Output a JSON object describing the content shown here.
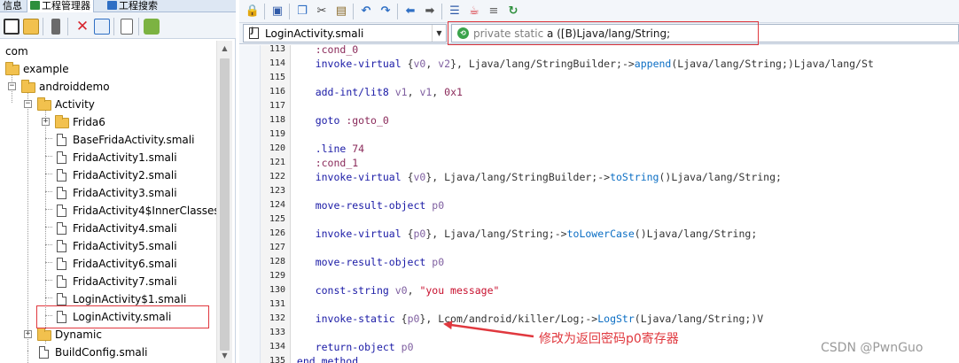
{
  "left_panel": {
    "tabs": [
      {
        "label": "信息"
      },
      {
        "label": "工程管理器"
      },
      {
        "label": "工程搜索"
      }
    ],
    "tree": [
      {
        "label": "com"
      },
      {
        "label": "example"
      },
      {
        "label": "androiddemo"
      },
      {
        "label": "Activity"
      },
      {
        "label": "Frida6"
      },
      {
        "label": "BaseFridaActivity.smali"
      },
      {
        "label": "FridaActivity1.smali"
      },
      {
        "label": "FridaActivity2.smali"
      },
      {
        "label": "FridaActivity3.smali"
      },
      {
        "label": "FridaActivity4$InnerClasses.s"
      },
      {
        "label": "FridaActivity4.smali"
      },
      {
        "label": "FridaActivity5.smali"
      },
      {
        "label": "FridaActivity6.smali"
      },
      {
        "label": "FridaActivity7.smali"
      },
      {
        "label": "LoginActivity$1.smali"
      },
      {
        "label": "LoginActivity.smali"
      },
      {
        "label": "Dynamic"
      },
      {
        "label": "BuildConfig.smali"
      }
    ]
  },
  "editor": {
    "file_name": "LoginActivity.smali",
    "method_modifiers": "private static",
    "method_signature": "a ([B)Ljava/lang/String;",
    "lines": [
      {
        "no": "113",
        "tokens": [
          {
            "t": "    "
          },
          {
            "c": "t-l",
            "t": ":cond_0"
          }
        ]
      },
      {
        "no": "114",
        "tokens": [
          {
            "t": "    "
          },
          {
            "c": "t-i",
            "t": "invoke-virtual "
          },
          {
            "c": "t-d",
            "t": "{"
          },
          {
            "c": "t-r",
            "t": "v0"
          },
          {
            "c": "t-d",
            "t": ", "
          },
          {
            "c": "t-r",
            "t": "v2"
          },
          {
            "c": "t-d",
            "t": "}, Ljava/lang/StringBuilder;->"
          },
          {
            "c": "t-m",
            "t": "append"
          },
          {
            "c": "t-d",
            "t": "(Ljava/lang/String;)Ljava/lang/St"
          }
        ]
      },
      {
        "no": "115",
        "tokens": [
          {
            "t": ""
          }
        ]
      },
      {
        "no": "116",
        "tokens": [
          {
            "t": "    "
          },
          {
            "c": "t-i",
            "t": "add-int/lit8 "
          },
          {
            "c": "t-r",
            "t": "v1"
          },
          {
            "c": "t-d",
            "t": ", "
          },
          {
            "c": "t-r",
            "t": "v1"
          },
          {
            "c": "t-d",
            "t": ", "
          },
          {
            "c": "t-n",
            "t": "0x1"
          }
        ]
      },
      {
        "no": "117",
        "tokens": [
          {
            "t": ""
          }
        ]
      },
      {
        "no": "118",
        "tokens": [
          {
            "t": "    "
          },
          {
            "c": "t-i",
            "t": "goto "
          },
          {
            "c": "t-l",
            "t": ":goto_0"
          }
        ]
      },
      {
        "no": "119",
        "tokens": [
          {
            "t": ""
          }
        ]
      },
      {
        "no": "120",
        "tokens": [
          {
            "t": "    "
          },
          {
            "c": "t-i",
            "t": ".line "
          },
          {
            "c": "t-n",
            "t": "74"
          }
        ]
      },
      {
        "no": "121",
        "tokens": [
          {
            "t": "    "
          },
          {
            "c": "t-l",
            "t": ":cond_1"
          }
        ]
      },
      {
        "no": "122",
        "tokens": [
          {
            "t": "    "
          },
          {
            "c": "t-i",
            "t": "invoke-virtual "
          },
          {
            "c": "t-d",
            "t": "{"
          },
          {
            "c": "t-r",
            "t": "v0"
          },
          {
            "c": "t-d",
            "t": "}, Ljava/lang/StringBuilder;->"
          },
          {
            "c": "t-m",
            "t": "toString"
          },
          {
            "c": "t-d",
            "t": "()Ljava/lang/String;"
          }
        ]
      },
      {
        "no": "123",
        "tokens": [
          {
            "t": ""
          }
        ]
      },
      {
        "no": "124",
        "tokens": [
          {
            "t": "    "
          },
          {
            "c": "t-i",
            "t": "move-result-object "
          },
          {
            "c": "t-r",
            "t": "p0"
          }
        ]
      },
      {
        "no": "125",
        "tokens": [
          {
            "t": ""
          }
        ]
      },
      {
        "no": "126",
        "tokens": [
          {
            "t": "    "
          },
          {
            "c": "t-i",
            "t": "invoke-virtual "
          },
          {
            "c": "t-d",
            "t": "{"
          },
          {
            "c": "t-r",
            "t": "p0"
          },
          {
            "c": "t-d",
            "t": "}, Ljava/lang/String;->"
          },
          {
            "c": "t-m",
            "t": "toLowerCase"
          },
          {
            "c": "t-d",
            "t": "()Ljava/lang/String;"
          }
        ]
      },
      {
        "no": "127",
        "tokens": [
          {
            "t": ""
          }
        ]
      },
      {
        "no": "128",
        "tokens": [
          {
            "t": "    "
          },
          {
            "c": "t-i",
            "t": "move-result-object "
          },
          {
            "c": "t-r",
            "t": "p0"
          }
        ]
      },
      {
        "no": "129",
        "tokens": [
          {
            "t": ""
          }
        ]
      },
      {
        "no": "130",
        "tokens": [
          {
            "t": "    "
          },
          {
            "c": "t-i",
            "t": "const-string "
          },
          {
            "c": "t-r",
            "t": "v0"
          },
          {
            "c": "t-d",
            "t": ", "
          },
          {
            "c": "t-s",
            "t": "\"you message\""
          }
        ]
      },
      {
        "no": "131",
        "tokens": [
          {
            "t": ""
          }
        ]
      },
      {
        "no": "132",
        "tokens": [
          {
            "t": "    "
          },
          {
            "c": "t-i",
            "t": "invoke-static "
          },
          {
            "c": "t-d",
            "t": "{"
          },
          {
            "c": "t-r",
            "t": "p0"
          },
          {
            "c": "t-d",
            "t": "}, Lcom/android/killer/Log;->"
          },
          {
            "c": "t-m",
            "t": "LogStr"
          },
          {
            "c": "t-d",
            "t": "(Ljava/lang/String;)V"
          }
        ]
      },
      {
        "no": "133",
        "tokens": [
          {
            "t": ""
          }
        ]
      },
      {
        "no": "134",
        "tokens": [
          {
            "t": "    "
          },
          {
            "c": "t-i",
            "t": "return-object "
          },
          {
            "c": "t-r",
            "t": "p0"
          }
        ]
      },
      {
        "no": "135",
        "tokens": [
          {
            "c": "t-i",
            "t": ".end method"
          }
        ]
      }
    ]
  },
  "annotation": {
    "text": "修改为返回密码p0寄存器",
    "color": "#e0383e"
  },
  "watermark": "CSDN @PwnGuo",
  "colors": {
    "highlight_red": "#e0383e",
    "folder_yellow": "#f2c14e",
    "toolbar_bg": "#f3f6fa"
  }
}
